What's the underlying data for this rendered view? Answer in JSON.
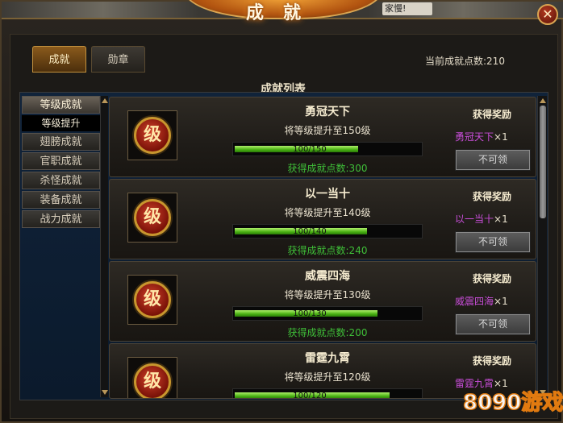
{
  "window": {
    "title": "成就",
    "top_message": "家慢!",
    "close_label": "✕"
  },
  "tabs": [
    {
      "label": "成就",
      "active": true
    },
    {
      "label": "勋章",
      "active": false
    }
  ],
  "points_label": "当前成就点数:210",
  "list_title": "成就列表",
  "sidebar": {
    "items": [
      "等级成就",
      "翅膀成就",
      "官职成就",
      "杀怪成就",
      "装备成就",
      "战力成就"
    ],
    "active_sub": "等级提升"
  },
  "cards": [
    {
      "badge": "级",
      "name": "勇冠天下",
      "desc": "将等级提升至150级",
      "progress_text": "100/150",
      "progress": 0.667,
      "points": "获得成就点数:300",
      "reward_title": "获得奖励",
      "reward_name": "勇冠天下",
      "reward_count": "×1",
      "button": "不可领"
    },
    {
      "badge": "级",
      "name": "以一当十",
      "desc": "将等级提升至140级",
      "progress_text": "100/140",
      "progress": 0.714,
      "points": "获得成就点数:240",
      "reward_title": "获得奖励",
      "reward_name": "以一当十",
      "reward_count": "×1",
      "button": "不可领"
    },
    {
      "badge": "级",
      "name": "威震四海",
      "desc": "将等级提升至130级",
      "progress_text": "100/130",
      "progress": 0.769,
      "points": "获得成就点数:200",
      "reward_title": "获得奖励",
      "reward_name": "威震四海",
      "reward_count": "×1",
      "button": "不可领"
    },
    {
      "badge": "级",
      "name": "雷霆九霄",
      "desc": "将等级提升至120级",
      "progress_text": "100/120",
      "progress": 0.833,
      "points": "",
      "reward_title": "获得奖励",
      "reward_name": "雷霆九霄",
      "reward_count": "×1",
      "button": ""
    }
  ],
  "watermark": {
    "text": "8090游戏"
  },
  "colors": {
    "accent": "#c4923e",
    "progress": "#48b012",
    "reward": "#c84dd8",
    "points": "#3fbf38"
  }
}
